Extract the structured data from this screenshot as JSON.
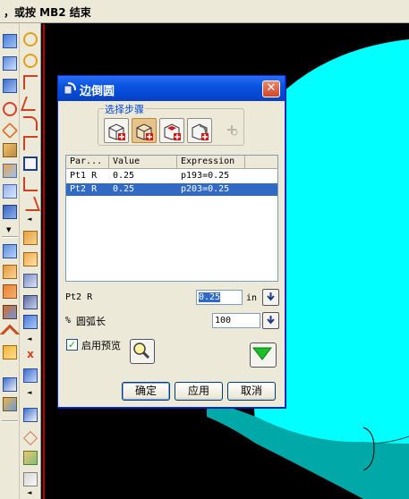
{
  "prompt": {
    "text": "，或按 MB2 结束"
  },
  "dialog": {
    "title": "边倒圆",
    "close_glyph": "✕",
    "steps_label": "选择步骤",
    "steps": [
      {
        "name": "edge-selection",
        "active": false
      },
      {
        "name": "variable-radius",
        "active": true
      },
      {
        "name": "corner-setback",
        "active": false
      },
      {
        "name": "stop-short",
        "active": false
      },
      {
        "name": "overflow",
        "active": false,
        "disabled": true
      }
    ],
    "table": {
      "columns": [
        "Par...",
        "Value",
        "Expression"
      ],
      "rows": [
        {
          "param": "Pt1 R",
          "value": "0.25",
          "expression": "p193=0.25",
          "selected": false
        },
        {
          "param": "Pt2 R",
          "value": "0.25",
          "expression": "p203=0.25",
          "selected": true
        }
      ]
    },
    "radius_field": {
      "label": "Pt2 R",
      "value": "0.25",
      "unit": "in"
    },
    "arc_length_field": {
      "label_prefix": "%",
      "label": "圆弧长",
      "value": "100"
    },
    "preview": {
      "label": "启用预览",
      "checked": true
    },
    "buttons": {
      "ok": "确定",
      "apply": "应用",
      "cancel": "取消"
    }
  },
  "colors": {
    "accent_blue": "#0a54e0",
    "selection": "#316ac5",
    "model_cyan": "#00ffff",
    "model_teal": "#00a8a8",
    "viewport_bg": "#000000",
    "dialog_bg": "#ece9d8"
  }
}
